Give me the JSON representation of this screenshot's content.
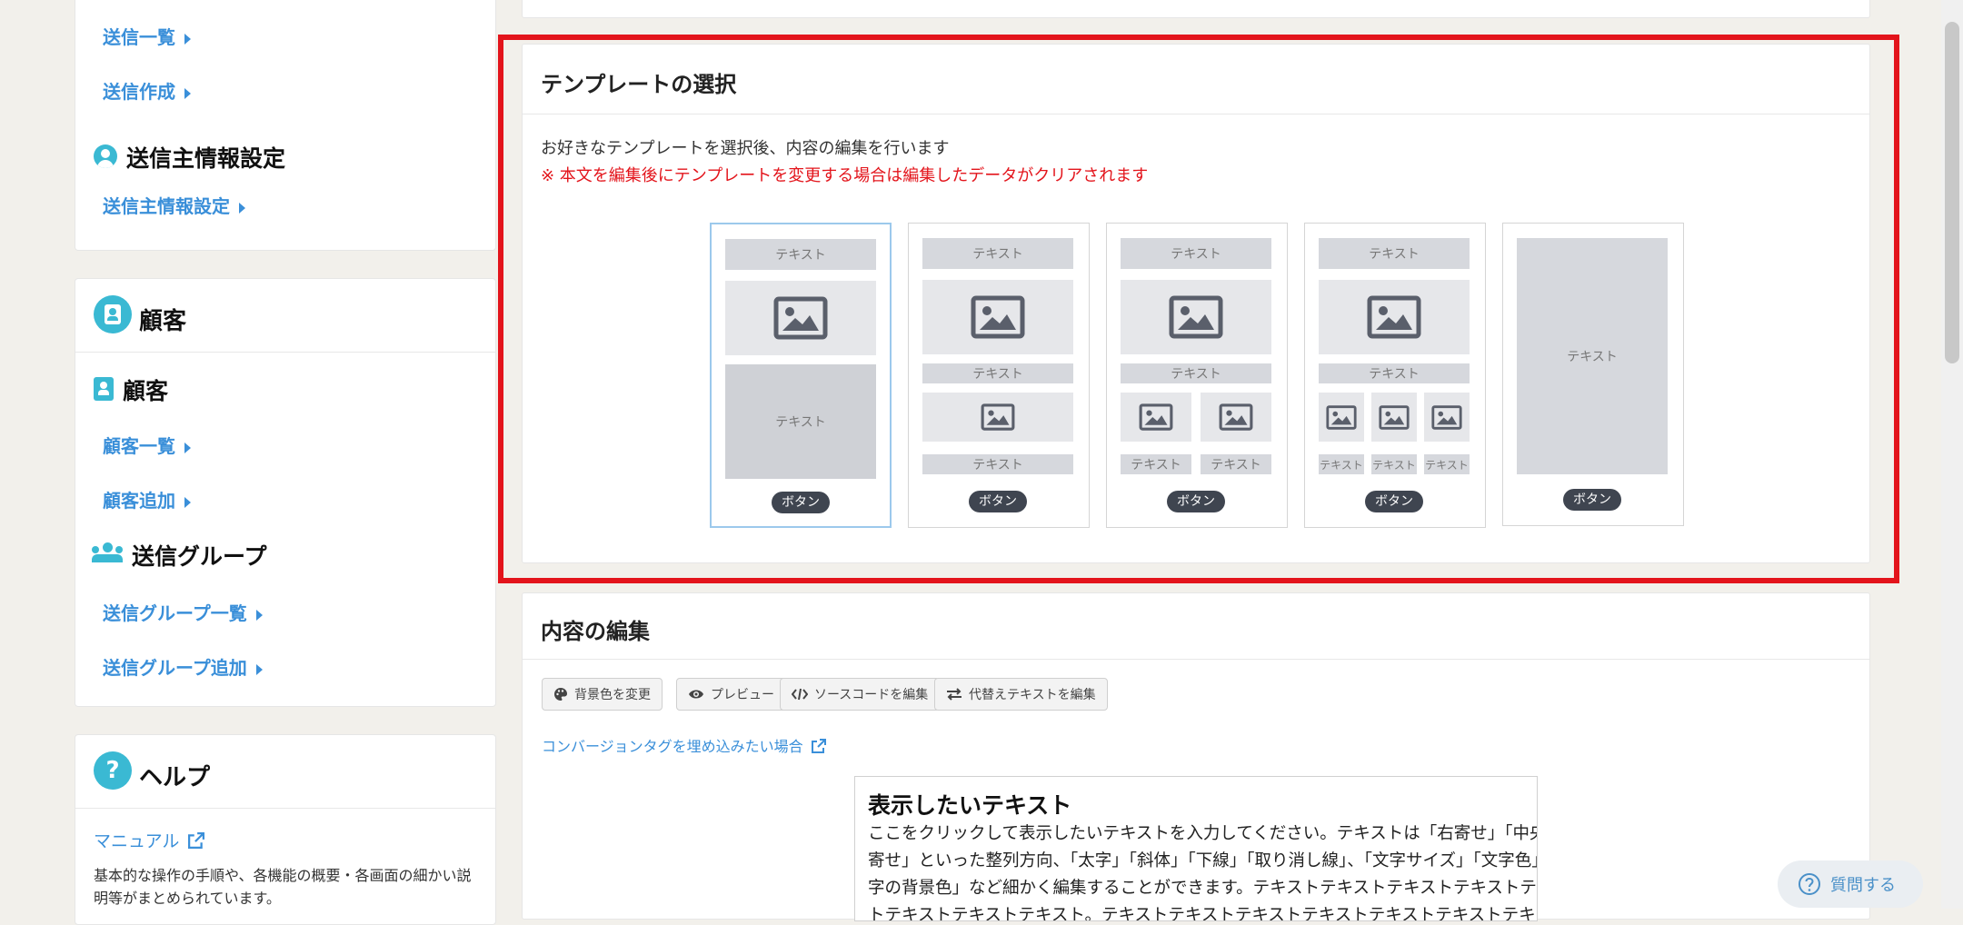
{
  "sidebar": {
    "send_list": "送信一覧",
    "send_create": "送信作成",
    "sender_settings_head": "送信主情報設定",
    "sender_settings_link": "送信主情報設定",
    "customer_head": "顧客",
    "customer_sub": "顧客",
    "customer_list": "顧客一覧",
    "customer_add": "顧客追加",
    "group_sub": "送信グループ",
    "group_list": "送信グループ一覧",
    "group_add": "送信グループ追加",
    "help_head": "ヘルプ",
    "help_icon": "?",
    "manual_link": "マニュアル",
    "manual_desc_1": "基本的な操作の手順や、各機能の概要・各画面の細かい説",
    "manual_desc_2": "明等がまとめられています。"
  },
  "template_section": {
    "title": "テンプレートの選択",
    "description": "お好きなテンプレートを選択後、内容の編集を行います",
    "warning": "※ 本文を編集後にテンプレートを変更する場合は編集したデータがクリアされます",
    "block_text": "テキスト",
    "button_text": "ボタン",
    "selected_index": 1
  },
  "edit_section": {
    "title": "内容の編集",
    "toolbar": {
      "bg_color": "背景色を変更",
      "preview": "プレビュー",
      "source": "ソースコードを編集",
      "alt_text": "代替えテキストを編集"
    },
    "conversion_link": "コンバージョンタグを埋め込みたい場合",
    "editor": {
      "heading": "表示したいテキスト",
      "line1": "ここをクリックして表示したいテキストを入力してください。テキストは「右寄せ」「中央寄せ」「左",
      "line2": "寄せ」といった整列方向、「太字」「斜体」「下線」「取り消し線」、「文字サイズ」「文字色」「文",
      "line3": "字の背景色」など細かく編集することができます。テキストテキストテキストテキストテキストテキス",
      "line4": "トテキストテキストテキスト。テキストテキストテキストテキストテキストテキストテキストテキスト"
    }
  },
  "help_button": "質問する",
  "colors": {
    "accent_link": "#3a8fd9",
    "warning": "#e3141b",
    "highlight_frame": "#e3141b",
    "icon_teal": "#3ab9d3"
  }
}
